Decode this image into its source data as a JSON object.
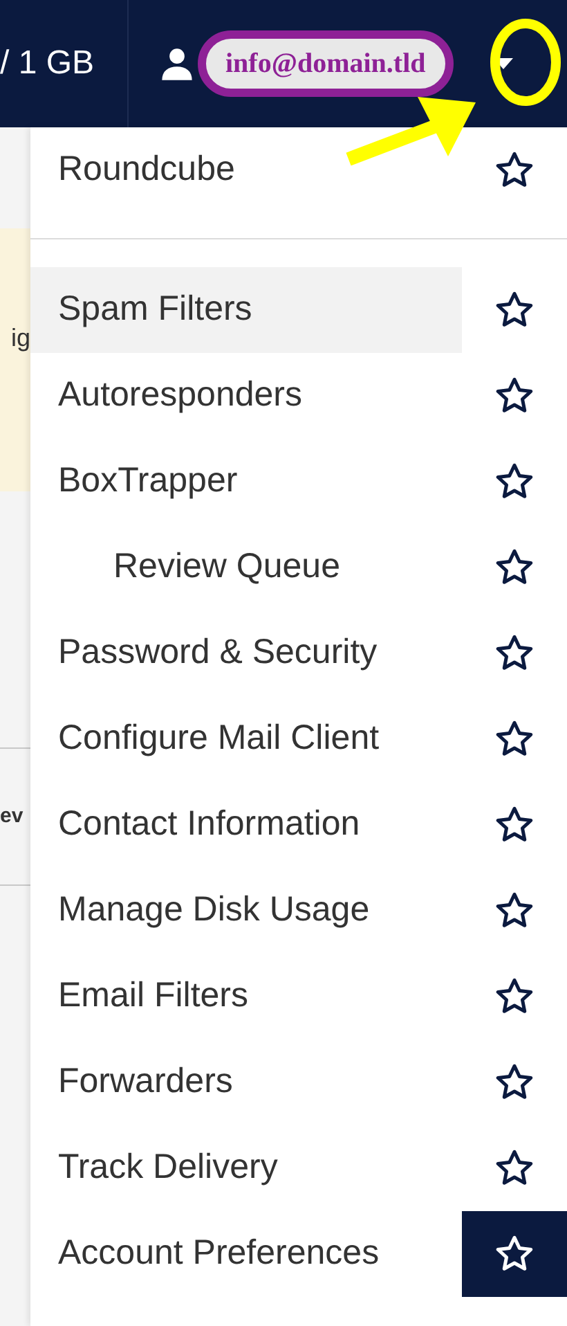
{
  "top_bar": {
    "quota_text": "/ 1 GB",
    "account_email": "info@domain.tld"
  },
  "background_page": {
    "fragments": [
      {
        "text": "ig",
        "kind": "notice"
      },
      {
        "text": "ev",
        "kind": "heading"
      }
    ]
  },
  "menu": {
    "items": [
      {
        "label": "Roundcube",
        "selected": false,
        "star_highlighted": false,
        "divider_after": true
      },
      {
        "label": "Spam Filters",
        "selected": true,
        "star_highlighted": false
      },
      {
        "label": "Autoresponders",
        "selected": false,
        "star_highlighted": false
      },
      {
        "label": "BoxTrapper",
        "selected": false,
        "star_highlighted": false,
        "children": [
          {
            "label": "Review Queue",
            "selected": false,
            "star_highlighted": false
          }
        ]
      },
      {
        "label": "Password & Security",
        "selected": false,
        "star_highlighted": false
      },
      {
        "label": "Configure Mail Client",
        "selected": false,
        "star_highlighted": false
      },
      {
        "label": "Contact Information",
        "selected": false,
        "star_highlighted": false
      },
      {
        "label": "Manage Disk Usage",
        "selected": false,
        "star_highlighted": false
      },
      {
        "label": "Email Filters",
        "selected": false,
        "star_highlighted": false
      },
      {
        "label": "Forwarders",
        "selected": false,
        "star_highlighted": false
      },
      {
        "label": "Track Delivery",
        "selected": false,
        "star_highlighted": false
      },
      {
        "label": "Account Preferences",
        "selected": false,
        "star_highlighted": true
      }
    ]
  }
}
